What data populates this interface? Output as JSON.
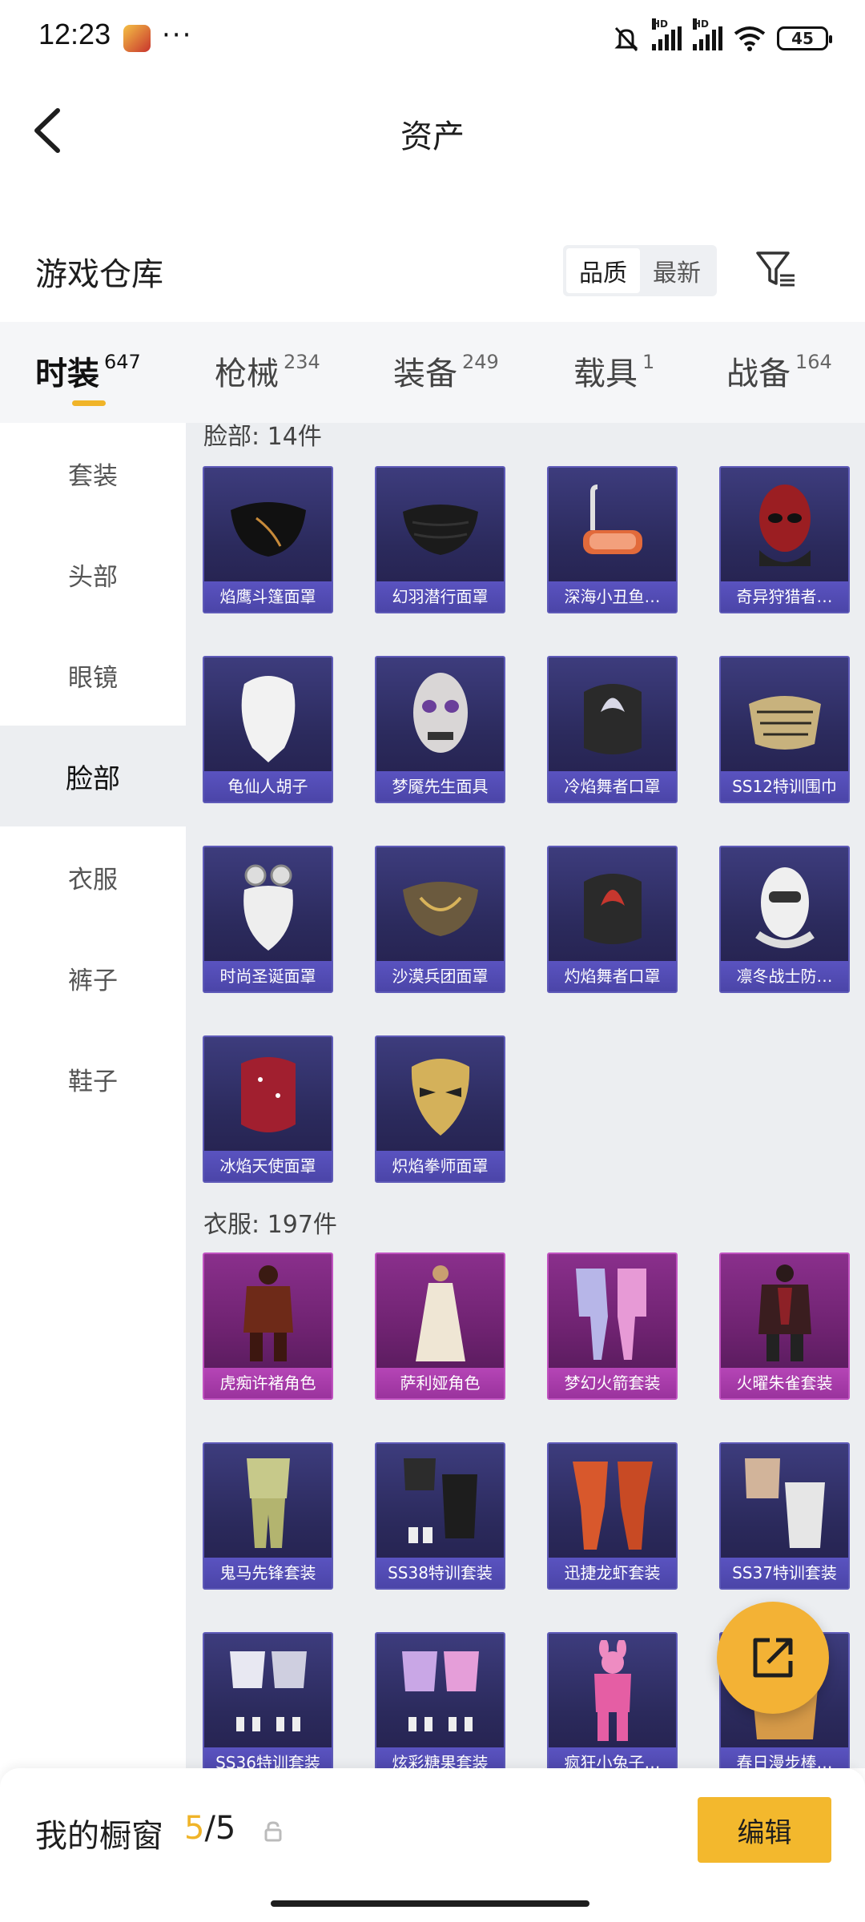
{
  "status_bar": {
    "time": "12:23",
    "battery": "45"
  },
  "header": {
    "title": "资产"
  },
  "warehouse": {
    "title": "游戏仓库",
    "sort_options": [
      "品质",
      "最新"
    ]
  },
  "tabs": [
    {
      "label": "时装",
      "count": "647"
    },
    {
      "label": "枪械",
      "count": "234"
    },
    {
      "label": "装备",
      "count": "249"
    },
    {
      "label": "载具",
      "count": "1"
    },
    {
      "label": "战备",
      "count": "164"
    }
  ],
  "sidebar": [
    "套装",
    "头部",
    "眼镜",
    "脸部",
    "衣服",
    "裤子",
    "鞋子"
  ],
  "sections": {
    "face": {
      "label": "脸部: 14件",
      "items": [
        "焰鹰斗篷面罩",
        "幻羽潜行面罩",
        "深海小丑鱼…",
        "奇异狩猎者…",
        "龟仙人胡子",
        "梦魇先生面具",
        "冷焰舞者口罩",
        "SS12特训围巾",
        "时尚圣诞面罩",
        "沙漠兵团面罩",
        "灼焰舞者口罩",
        "凛冬战士防…",
        "冰焰天使面罩",
        "炽焰拳师面罩"
      ]
    },
    "clothes": {
      "label": "衣服: 197件",
      "items": [
        "虎痴许褚角色",
        "萨利娅角色",
        "梦幻火箭套装",
        "火曜朱雀套装",
        "鬼马先锋套装",
        "SS38特训套装",
        "迅捷龙虾套装",
        "SS37特训套装",
        "SS36特训套装",
        "炫彩糖果套装",
        "疯狂小兔子…",
        "春日漫步棒…"
      ]
    }
  },
  "bottom_bar": {
    "label": "我的橱窗",
    "count_current": "5",
    "count_total": "/5",
    "edit_label": "编辑"
  },
  "colors": {
    "accent": "#f0b429",
    "card_purple": "#2b2a5c",
    "card_pink": "#6d226f"
  }
}
